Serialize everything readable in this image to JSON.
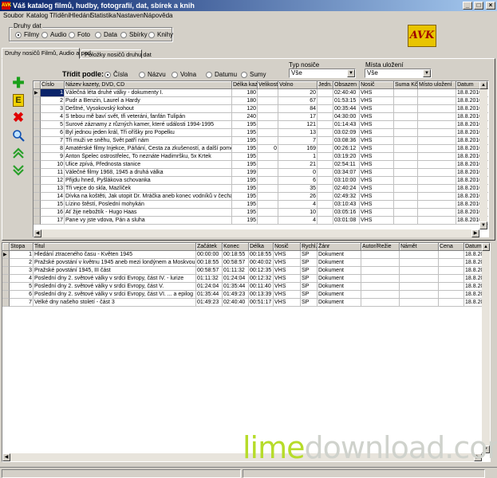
{
  "window": {
    "title": "Váš katalog filmů, hudby, fotografií, dat, sbírek a knih",
    "app_icon": "AVK"
  },
  "menu": [
    "Soubor",
    "Katalog",
    "Třídění",
    "Hledání",
    "Statistika",
    "Nastavení",
    "Nápověda"
  ],
  "media_types": {
    "title": "Druhy dat",
    "options": [
      "Filmy",
      "Audio",
      "Foto",
      "Data",
      "Sbírky",
      "Knihy"
    ],
    "selected": 0
  },
  "logo_text": "AVK",
  "tabs": [
    "Druhy nosičů Filmů, Audio a pod.",
    "Položky nosičů druhu dat"
  ],
  "sort": {
    "label": "Třídit podle:",
    "options": [
      "Čísla",
      "Názvu",
      "Volna",
      "Datumu",
      "Sumy"
    ],
    "selected": 0
  },
  "filters": {
    "media_label": "Typ nosiče",
    "media_value": "Vše",
    "location_label": "Místa uložení",
    "location_value": "Vše"
  },
  "toolbar_icons": [
    "add-icon",
    "edit-icon",
    "delete-icon",
    "search-icon",
    "move-up-icon",
    "move-down-icon"
  ],
  "top_table": {
    "columns": [
      "Číslo",
      "Název kazety, DVD, CD",
      "Délka kaz.",
      "Velikost",
      "Volno",
      "Jedn.",
      "Obsazen",
      "Nosič",
      "Suma Kč",
      "Místo uložení",
      "Datum"
    ],
    "rows": [
      [
        "1",
        "Válečná léta druhé války - dokumenty I.",
        "180",
        "",
        "20",
        "",
        "02:40:40",
        "VHS",
        "",
        "",
        "18.8.2010"
      ],
      [
        "2",
        "Pudr a Benzin, Laurel a Hardy",
        "180",
        "",
        "67",
        "",
        "01:53:15",
        "VHS",
        "",
        "",
        "18.8.2010"
      ],
      [
        "3",
        "Deštné, Vysokovský kohout",
        "120",
        "",
        "84",
        "",
        "00:35:44",
        "VHS",
        "",
        "",
        "18.8.2010"
      ],
      [
        "4",
        "S tebou mě baví svět, tři veteráni, fanfán Tulipán",
        "240",
        "",
        "17",
        "",
        "04:30:00",
        "VHS",
        "",
        "",
        "18.8.2010"
      ],
      [
        "5",
        "Surové záznamy z různých kamer, které události 1994-1995",
        "195",
        "",
        "121",
        "",
        "01:14:43",
        "VHS",
        "",
        "",
        "18.8.2010"
      ],
      [
        "6",
        "Byl jednou jeden král, Tři oříšky pro Popelku",
        "195",
        "",
        "13",
        "",
        "03:02:09",
        "VHS",
        "",
        "",
        "18.8.2010"
      ],
      [
        "7",
        "Tři muži ve sněhu, Svět patří nám",
        "195",
        "",
        "7",
        "",
        "03:08:36",
        "VHS",
        "",
        "",
        "18.8.2010"
      ],
      [
        "8",
        "Amatérské filmy Injekce, Páňání, Cesta za zkušeností, a další pomocné, kter",
        "195",
        "0",
        "169",
        "",
        "00:26:12",
        "VHS",
        "",
        "",
        "18.8.2010"
      ],
      [
        "9",
        "Anton Špelec ostrostřelec, To neznáte Hadimršku, 5x Krtek",
        "195",
        "",
        "1",
        "",
        "03:19:20",
        "VHS",
        "",
        "",
        "18.8.2010"
      ],
      [
        "10",
        "Ulice zpívá, Přednosta stanice",
        "195",
        "",
        "21",
        "",
        "02:54:11",
        "VHS",
        "",
        "",
        "18.8.2010"
      ],
      [
        "11",
        "Válečné filmy 1968, 1945 a druhá válka",
        "199",
        "",
        "0",
        "",
        "03:34:07",
        "VHS",
        "",
        "",
        "18.8.2010"
      ],
      [
        "12",
        "Přijdu hned, Pyšlákova schovanka",
        "195",
        "",
        "6",
        "",
        "03:10:00",
        "VHS",
        "",
        "",
        "18.8.2010"
      ],
      [
        "13",
        "Tři vejce do skla, Mazlíček",
        "195",
        "",
        "35",
        "",
        "02:40:24",
        "VHS",
        "",
        "",
        "18.8.2010"
      ],
      [
        "14",
        "Dívka na koštěti, Jak utopit Dr. Mráčka aneb konec vodníků v čechách",
        "195",
        "",
        "26",
        "",
        "02:49:32",
        "VHS",
        "",
        "",
        "18.8.2010"
      ],
      [
        "15",
        "Lízino štěstí, Poslední mohykán",
        "195",
        "",
        "4",
        "",
        "03:10:43",
        "VHS",
        "",
        "",
        "18.8.2010"
      ],
      [
        "16",
        "Ať žije nebožtík - Hugo Haas",
        "195",
        "",
        "10",
        "",
        "03:05:16",
        "VHS",
        "",
        "",
        "18.8.2010"
      ],
      [
        "17",
        "Pane vy jste vdova, Pán a sluha",
        "195",
        "",
        "4",
        "",
        "03:01:08",
        "VHS",
        "",
        "",
        "18.8.2010"
      ]
    ]
  },
  "bottom_table": {
    "columns": [
      "Stopa",
      "Titul",
      "Začátek",
      "Konec",
      "Délka",
      "Nosič",
      "Rychl.",
      "Žánr",
      "Autor/Režie",
      "Námět",
      "Cena",
      "Datum"
    ],
    "rows": [
      [
        "1",
        "Hledání ztraceného času - Květen 1945",
        "00:00:00",
        "00:18:55",
        "00:18:55",
        "VHS",
        "SP",
        "Dokument",
        "",
        "",
        "",
        "18.8.2010"
      ],
      [
        "2",
        "Pražské povstání v květnu 1945 aneb mezi londýnem a Moskvou",
        "00:18:55",
        "00:58:57",
        "00:40:02",
        "VHS",
        "SP",
        "Dokument",
        "",
        "",
        "",
        "18.8.2010"
      ],
      [
        "3",
        "Pražské povstání 1945, III část",
        "00:58:57",
        "01:11:32",
        "00:12:35",
        "VHS",
        "SP",
        "Dokument",
        "",
        "",
        "",
        "18.8.2010"
      ],
      [
        "4",
        "Poslední dny 2. světové války v srdci Evropy, část IV. - lurize",
        "01:11:32",
        "01:24:04",
        "00:12:32",
        "VHS",
        "SP",
        "Dokument",
        "",
        "",
        "",
        "18.8.2010"
      ],
      [
        "5",
        "Poslední dny 2. světové války v srdci Evropy, část V.",
        "01:24:04",
        "01:35:44",
        "00:11:40",
        "VHS",
        "SP",
        "Dokument",
        "",
        "",
        "",
        "18.8.2010"
      ],
      [
        "6",
        "Poslední dny 2. světové války v srdci Evropy, část VI. ... a epilog",
        "01:35:44",
        "01:49:23",
        "00:13:39",
        "VHS",
        "SP",
        "Dokument",
        "",
        "",
        "",
        "18.8.2010"
      ],
      [
        "7",
        "Velké dny našeho století - část 3",
        "01:49:23",
        "02:40:40",
        "00:51:17",
        "VHS",
        "SP",
        "Dokument",
        "",
        "",
        "",
        "18.8.2010"
      ]
    ]
  },
  "watermark": {
    "part1": "lime",
    "part2": "download.com"
  },
  "colors": {
    "selection": "#0a246a",
    "face": "#d4d0c8",
    "watermark_green": "#b6dc2a"
  }
}
